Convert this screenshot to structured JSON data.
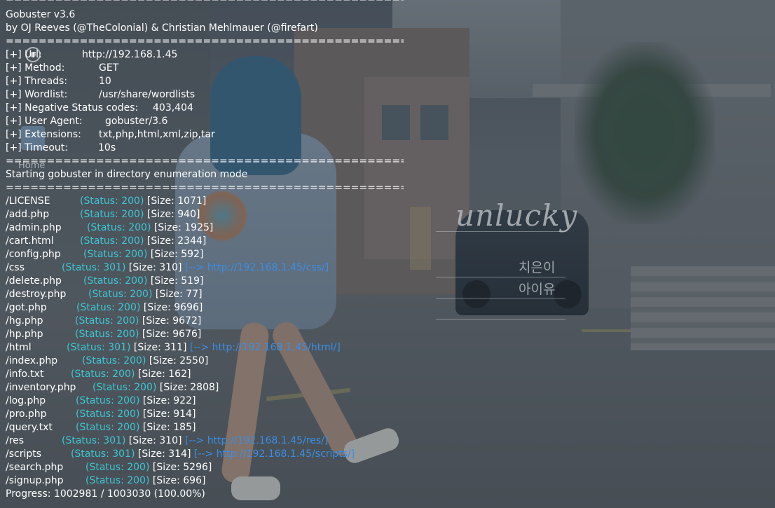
{
  "wallpaper": {
    "title_text": "unlucky",
    "subtitle_1": "치은이",
    "subtitle_2": "아이유",
    "home_label": "Home",
    "icons": [
      "home-folder-icon",
      "circle-app-icon"
    ]
  },
  "colors": {
    "text": "#ffffff",
    "status": "#3ec6d4",
    "redirect": "#3a8ee6"
  },
  "terminal": {
    "separator": "=====================================================================",
    "header": {
      "name": "Gobuster v3.6",
      "authors": "by OJ Reeves (@TheColonial) & Christian Mehlmauer (@firefart)"
    },
    "config": [
      {
        "label": "[+] Url:",
        "value": "http://192.168.1.45"
      },
      {
        "label": "[+] Method:",
        "value": "GET"
      },
      {
        "label": "[+] Threads:",
        "value": "10"
      },
      {
        "label": "[+] Wordlist:",
        "value": "/usr/share/wordlists"
      },
      {
        "label": "[+] Negative Status codes:",
        "value": "403,404"
      },
      {
        "label": "[+] User Agent:",
        "value": "gobuster/3.6"
      },
      {
        "label": "[+] Extensions:",
        "value": "txt,php,html,xml,zip,tar"
      },
      {
        "label": "[+] Timeout:",
        "value": "10s"
      }
    ],
    "start_message": "Starting gobuster in directory enumeration mode",
    "results": [
      {
        "path": "/LICENSE",
        "status": "(Status: 200)",
        "size": "[Size: 1071]",
        "redirect": ""
      },
      {
        "path": "/add.php",
        "status": "(Status: 200)",
        "size": "[Size: 940]",
        "redirect": ""
      },
      {
        "path": "/admin.php",
        "status": "(Status: 200)",
        "size": "[Size: 1925]",
        "redirect": ""
      },
      {
        "path": "/cart.html",
        "status": "(Status: 200)",
        "size": "[Size: 2344]",
        "redirect": ""
      },
      {
        "path": "/config.php",
        "status": "(Status: 200)",
        "size": "[Size: 592]",
        "redirect": ""
      },
      {
        "path": "/css",
        "status": "(Status: 301)",
        "size": "[Size: 310]",
        "redirect": "[--> http://192.168.1.45/css/]"
      },
      {
        "path": "/delete.php",
        "status": "(Status: 200)",
        "size": "[Size: 519]",
        "redirect": ""
      },
      {
        "path": "/destroy.php",
        "status": "(Status: 200)",
        "size": "[Size: 77]",
        "redirect": ""
      },
      {
        "path": "/got.php",
        "status": "(Status: 200)",
        "size": "[Size: 9696]",
        "redirect": ""
      },
      {
        "path": "/hg.php",
        "status": "(Status: 200)",
        "size": "[Size: 9672]",
        "redirect": ""
      },
      {
        "path": "/hp.php",
        "status": "(Status: 200)",
        "size": "[Size: 9676]",
        "redirect": ""
      },
      {
        "path": "/html",
        "status": "(Status: 301)",
        "size": "[Size: 311]",
        "redirect": "[--> http://192.168.1.45/html/]"
      },
      {
        "path": "/index.php",
        "status": "(Status: 200)",
        "size": "[Size: 2550]",
        "redirect": ""
      },
      {
        "path": "/info.txt",
        "status": "(Status: 200)",
        "size": "[Size: 162]",
        "redirect": ""
      },
      {
        "path": "/inventory.php",
        "status": "(Status: 200)",
        "size": "[Size: 2808]",
        "redirect": ""
      },
      {
        "path": "/log.php",
        "status": "(Status: 200)",
        "size": "[Size: 922]",
        "redirect": ""
      },
      {
        "path": "/pro.php",
        "status": "(Status: 200)",
        "size": "[Size: 914]",
        "redirect": ""
      },
      {
        "path": "/query.txt",
        "status": "(Status: 200)",
        "size": "[Size: 185]",
        "redirect": ""
      },
      {
        "path": "/res",
        "status": "(Status: 301)",
        "size": "[Size: 310]",
        "redirect": "[--> http://192.168.1.45/res/]"
      },
      {
        "path": "/scripts",
        "status": "(Status: 301)",
        "size": "[Size: 314]",
        "redirect": "[--> http://192.168.1.45/scripts/]"
      },
      {
        "path": "/search.php",
        "status": "(Status: 200)",
        "size": "[Size: 5296]",
        "redirect": ""
      },
      {
        "path": "/signup.php",
        "status": "(Status: 200)",
        "size": "[Size: 696]",
        "redirect": ""
      }
    ],
    "progress": "Progress: 1002981 / 1003030 (100.00%)"
  }
}
